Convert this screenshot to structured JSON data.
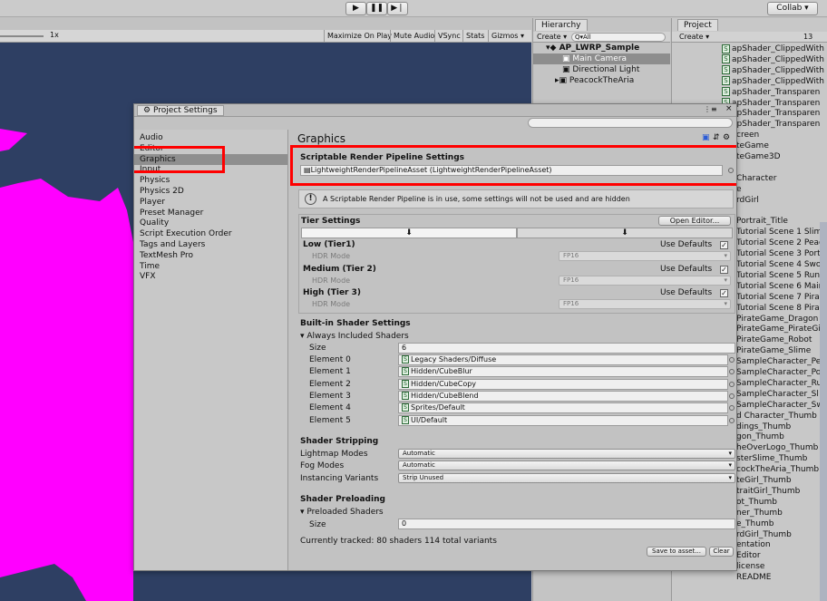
{
  "toolbar": {
    "play_icon": "play-icon",
    "pause_icon": "pause-icon",
    "step_icon": "step-icon",
    "collab_label": "Collab ▾"
  },
  "scene": {
    "scale_label": "1x",
    "buttons": [
      "Maximize On Play",
      "Mute Audio",
      "VSync",
      "Stats",
      "Gizmos ▾"
    ]
  },
  "hierarchy": {
    "tab": "Hierarchy",
    "create": "Create ▾",
    "search_placeholder": "Q▾All",
    "scene_name": "AP_LWRP_Sample",
    "items": [
      "Main Camera",
      "Directional Light",
      "PeacockTheAria"
    ]
  },
  "project": {
    "tab": "Project",
    "create": "Create ▾",
    "count": "13",
    "items": [
      "apShader_ClippedWith",
      "apShader_ClippedWith",
      "apShader_ClippedWith",
      "apShader_ClippedWith",
      "apShader_Transparen",
      "apShader_Transparen",
      "apShader_Transparen",
      "apShader_Transparen",
      "creen",
      "teGame",
      "teGame3D",
      "",
      "Character",
      "e",
      "rdGirl",
      "",
      "Portrait_Title",
      "Tutorial Scene 1 Slim",
      "Tutorial Scene 2 Peac",
      "Tutorial Scene 3 Port",
      "Tutorial Scene 4 Swo",
      "Tutorial Scene 5 Runn",
      "Tutorial Scene 6 Main",
      "Tutorial Scene 7 Pirat",
      "Tutorial Scene 8 Pirat",
      "PirateGame_Dragon",
      "PirateGame_PirateGi",
      "PirateGame_Robot",
      "PirateGame_Slime",
      "SampleCharacter_Pe",
      "SampleCharacter_Po",
      "SampleCharacter_Ru",
      "SampleCharacter_Sl",
      "SampleCharacter_Sw",
      "d Character_Thumb",
      "dings_Thumb",
      "gon_Thumb",
      "heOverLogo_Thumb",
      "sterSlime_Thumb",
      "cockTheAria_Thumb",
      "teGirl_Thumb",
      "traitGirl_Thumb",
      "ot_Thumb",
      "ner_Thumb",
      "e_Thumb",
      "rdGirl_Thumb",
      "entation",
      "Editor",
      "license",
      "README"
    ]
  },
  "settings": {
    "window_title": "Project Settings",
    "search_placeholder": "",
    "categories": [
      "Audio",
      "Editor",
      "Graphics",
      "Input",
      "Physics",
      "Physics 2D",
      "Player",
      "Preset Manager",
      "Quality",
      "Script Execution Order",
      "Tags and Layers",
      "TextMesh Pro",
      "Time",
      "VFX"
    ],
    "selected_category": "Graphics",
    "page_title": "Graphics",
    "srp": {
      "header": "Scriptable Render Pipeline Settings",
      "asset": "LightweightRenderPipelineAsset (LightweightRenderPipelineAsset)",
      "warning": "A Scriptable Render Pipeline is in use, some settings will not be used and are hidden"
    },
    "tier": {
      "header": "Tier Settings",
      "open_editor": "Open Editor...",
      "tiers": [
        {
          "name": "Low (Tier1)",
          "use_defaults": "Use Defaults",
          "hdr_label": "HDR Mode",
          "hdr_value": "FP16"
        },
        {
          "name": "Medium (Tier 2)",
          "use_defaults": "Use Defaults",
          "hdr_label": "HDR Mode",
          "hdr_value": "FP16"
        },
        {
          "name": "High (Tier 3)",
          "use_defaults": "Use Defaults",
          "hdr_label": "HDR Mode",
          "hdr_value": "FP16"
        }
      ]
    },
    "builtin": {
      "header": "Built-in Shader Settings",
      "always_included": "Always Included Shaders",
      "size_label": "Size",
      "size_value": "6",
      "elements": [
        {
          "label": "Element 0",
          "value": "Legacy Shaders/Diffuse"
        },
        {
          "label": "Element 1",
          "value": "Hidden/CubeBlur"
        },
        {
          "label": "Element 2",
          "value": "Hidden/CubeCopy"
        },
        {
          "label": "Element 3",
          "value": "Hidden/CubeBlend"
        },
        {
          "label": "Element 4",
          "value": "Sprites/Default"
        },
        {
          "label": "Element 5",
          "value": "UI/Default"
        }
      ]
    },
    "stripping": {
      "header": "Shader Stripping",
      "rows": [
        {
          "label": "Lightmap Modes",
          "value": "Automatic"
        },
        {
          "label": "Fog Modes",
          "value": "Automatic"
        },
        {
          "label": "Instancing Variants",
          "value": "Strip Unused"
        }
      ]
    },
    "preloading": {
      "header": "Shader Preloading",
      "preloaded": "Preloaded Shaders",
      "size_label": "Size",
      "size_value": "0",
      "tracked": "Currently tracked: 80 shaders 114 total variants",
      "save_button": "Save to asset...",
      "clear_button": "Clear"
    }
  },
  "colors": {
    "scene_bg": "#2e3f63",
    "magenta": "#ff00ff",
    "highlight": "#ff0000"
  }
}
